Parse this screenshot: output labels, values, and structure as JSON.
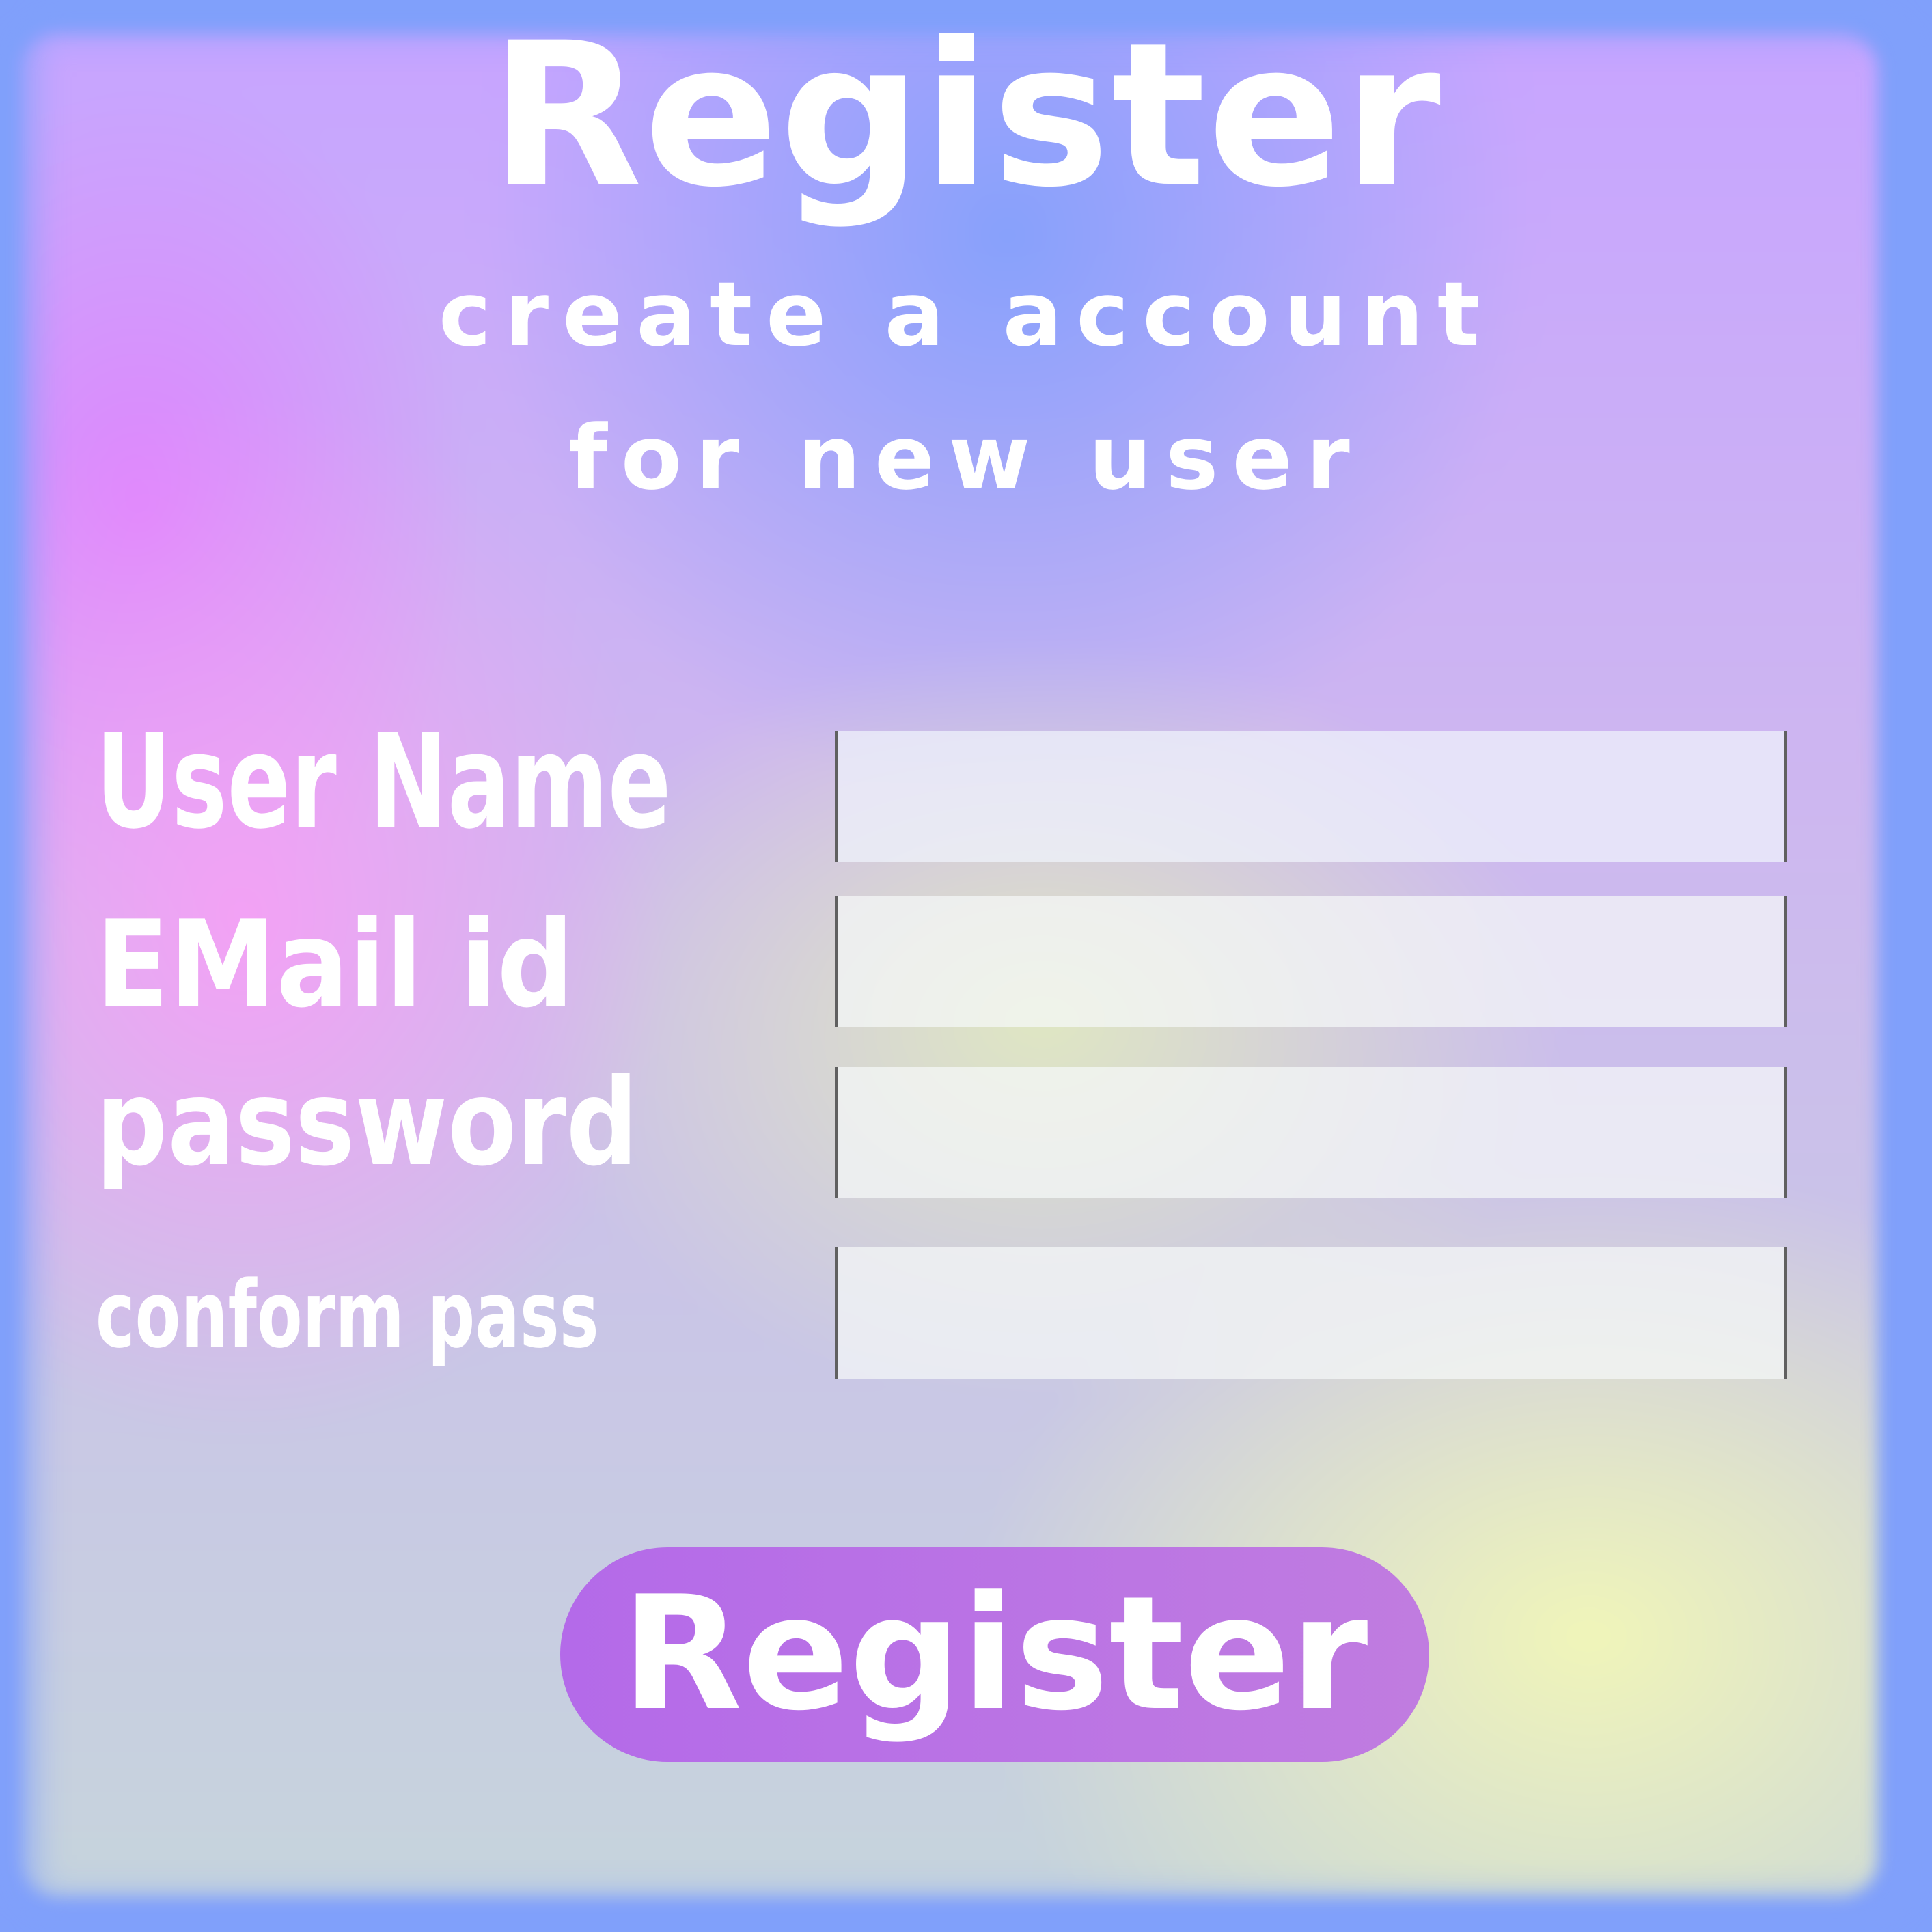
{
  "header": {
    "title": "Register",
    "subtitle_line1": "create a account",
    "subtitle_line2": "for new user"
  },
  "form": {
    "fields": [
      {
        "label": "User Name",
        "value": ""
      },
      {
        "label": "EMail id",
        "value": ""
      },
      {
        "label": "password",
        "value": ""
      },
      {
        "label": "conform pass",
        "value": ""
      }
    ],
    "submit_label": "Register"
  },
  "colors": {
    "background": "#80a0fb",
    "button": "#b46ae9",
    "text": "#ffffff"
  }
}
